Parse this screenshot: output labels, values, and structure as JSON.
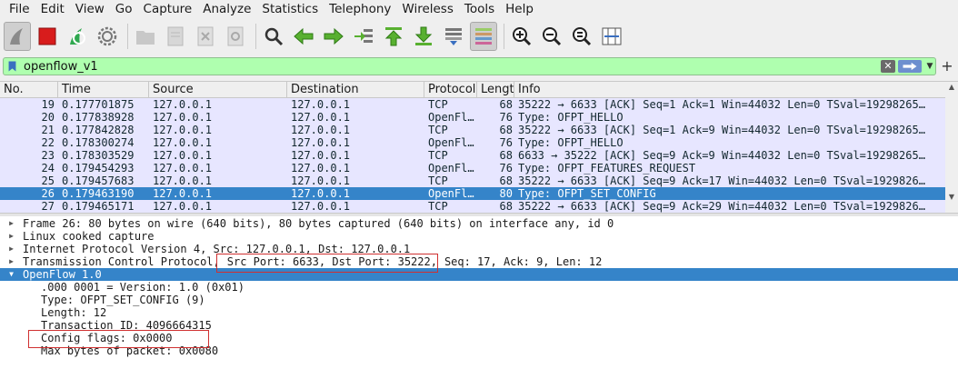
{
  "menu": {
    "items": [
      {
        "label": "File"
      },
      {
        "label": "Edit"
      },
      {
        "label": "View"
      },
      {
        "label": "Go"
      },
      {
        "label": "Capture"
      },
      {
        "label": "Analyze"
      },
      {
        "label": "Statistics"
      },
      {
        "label": "Telephony"
      },
      {
        "label": "Wireless"
      },
      {
        "label": "Tools"
      },
      {
        "label": "Help"
      }
    ]
  },
  "toolbar": {
    "buttons": [
      {
        "icon": "shark-fin-start-icon"
      },
      {
        "icon": "stop-capture-icon"
      },
      {
        "icon": "restart-capture-icon"
      },
      {
        "icon": "capture-options-icon"
      },
      {
        "icon": "open-file-icon"
      },
      {
        "icon": "save-file-icon"
      },
      {
        "icon": "close-file-icon"
      },
      {
        "icon": "reload-file-icon"
      },
      {
        "icon": "find-packet-icon"
      },
      {
        "icon": "go-back-icon"
      },
      {
        "icon": "go-forward-icon"
      },
      {
        "icon": "go-to-packet-icon"
      },
      {
        "icon": "first-packet-icon"
      },
      {
        "icon": "last-packet-icon"
      },
      {
        "icon": "autoscroll-icon"
      },
      {
        "icon": "colorize-icon"
      },
      {
        "icon": "zoom-in-icon"
      },
      {
        "icon": "zoom-out-icon"
      },
      {
        "icon": "normal-size-icon"
      },
      {
        "icon": "resize-columns-icon"
      }
    ],
    "colors": {
      "filter_bg": "#afffaf",
      "selected": "#3584c9",
      "row_bg": "#e7e6ff",
      "highlight_box": "#d03030"
    }
  },
  "filter": {
    "value": "openflow_v1"
  },
  "packet_list": {
    "columns": [
      "No.",
      "Time",
      "Source",
      "Destination",
      "Protocol",
      "Length",
      "Info"
    ],
    "rows": [
      {
        "no": "19",
        "time": "0.177701875",
        "src": "127.0.0.1",
        "dst": "127.0.0.1",
        "proto": "TCP",
        "len": "68",
        "info": "35222 → 6633 [ACK] Seq=1 Ack=1 Win=44032 Len=0 TSval=19298265…",
        "selected": false
      },
      {
        "no": "20",
        "time": "0.177838928",
        "src": "127.0.0.1",
        "dst": "127.0.0.1",
        "proto": "OpenFl…",
        "len": "76",
        "info": "Type: OFPT_HELLO",
        "selected": false
      },
      {
        "no": "21",
        "time": "0.177842828",
        "src": "127.0.0.1",
        "dst": "127.0.0.1",
        "proto": "TCP",
        "len": "68",
        "info": "35222 → 6633 [ACK] Seq=1 Ack=9 Win=44032 Len=0 TSval=19298265…",
        "selected": false
      },
      {
        "no": "22",
        "time": "0.178300274",
        "src": "127.0.0.1",
        "dst": "127.0.0.1",
        "proto": "OpenFl…",
        "len": "76",
        "info": "Type: OFPT_HELLO",
        "selected": false
      },
      {
        "no": "23",
        "time": "0.178303529",
        "src": "127.0.0.1",
        "dst": "127.0.0.1",
        "proto": "TCP",
        "len": "68",
        "info": "6633 → 35222 [ACK] Seq=9 Ack=9 Win=44032 Len=0 TSval=19298265…",
        "selected": false
      },
      {
        "no": "24",
        "time": "0.179454293",
        "src": "127.0.0.1",
        "dst": "127.0.0.1",
        "proto": "OpenFl…",
        "len": "76",
        "info": "Type: OFPT_FEATURES_REQUEST",
        "selected": false
      },
      {
        "no": "25",
        "time": "0.179457683",
        "src": "127.0.0.1",
        "dst": "127.0.0.1",
        "proto": "TCP",
        "len": "68",
        "info": "35222 → 6633 [ACK] Seq=9 Ack=17 Win=44032 Len=0 TSval=1929826…",
        "selected": false
      },
      {
        "no": "26",
        "time": "0.179463190",
        "src": "127.0.0.1",
        "dst": "127.0.0.1",
        "proto": "OpenFl…",
        "len": "80",
        "info": "Type: OFPT_SET_CONFIG",
        "selected": true
      },
      {
        "no": "27",
        "time": "0.179465171",
        "src": "127.0.0.1",
        "dst": "127.0.0.1",
        "proto": "TCP",
        "len": "68",
        "info": "35222 → 6633 [ACK] Seq=9 Ack=29 Win=44032 Len=0 TSval=1929826…",
        "selected": false
      }
    ]
  },
  "details": {
    "frame": "Frame 26: 80 bytes on wire (640 bits), 80 bytes captured (640 bits) on interface any, id 0",
    "linux": "Linux cooked capture",
    "ip": "Internet Protocol Version 4, Src: 127.0.0.1, Dst: 127.0.0.1",
    "tcp_prefix": "Transmission Control Protocol,",
    "tcp_ports": "Src Port: 6633, Dst Port: 35222,",
    "tcp_suffix": "Seq: 17, Ack: 9, Len: 12",
    "openflow": "OpenFlow 1.0",
    "version": ".000 0001 = Version: 1.0 (0x01)",
    "type": "Type: OFPT_SET_CONFIG (9)",
    "length": "Length: 12",
    "xid": "Transaction ID: 4096664315",
    "flags": "Config flags: 0x0000",
    "max_bytes": "Max bytes of packet: 0x0080"
  }
}
